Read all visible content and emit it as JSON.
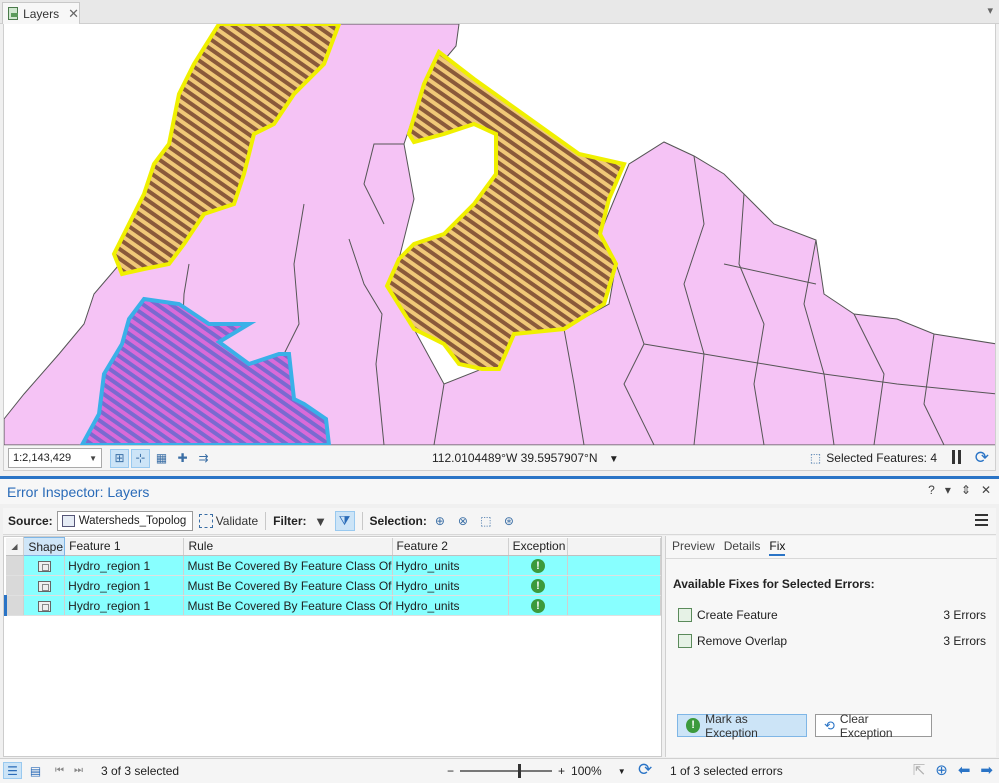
{
  "tab": {
    "label": "Layers"
  },
  "mapbar": {
    "scale": "1:2,143,429",
    "coordinates": "112.0104489°W 39.5957907°N",
    "selected_features": "Selected Features: 4"
  },
  "pane": {
    "title": "Error Inspector: Layers",
    "controls": [
      "?",
      "▾",
      "⇕",
      "✕"
    ]
  },
  "toolbar": {
    "source_label": "Source:",
    "source_value": "Watersheds_Topolog",
    "validate_label": "Validate",
    "filter_label": "Filter:",
    "selection_label": "Selection:"
  },
  "table": {
    "columns": [
      "Shape",
      "Feature 1",
      "Rule",
      "Feature 2",
      "Exception"
    ],
    "rows": [
      {
        "feature1": "Hydro_region 1",
        "rule": "Must Be Covered By Feature Class Of",
        "feature2": "Hydro_units"
      },
      {
        "feature1": "Hydro_region 1",
        "rule": "Must Be Covered By Feature Class Of",
        "feature2": "Hydro_units"
      },
      {
        "feature1": "Hydro_region 1",
        "rule": "Must Be Covered By Feature Class Of",
        "feature2": "Hydro_units"
      }
    ]
  },
  "fixpanel": {
    "tabs": [
      "Preview",
      "Details",
      "Fix"
    ],
    "heading": "Available Fixes for Selected Errors:",
    "fixes": [
      {
        "label": "Create Feature",
        "count": "3  Errors"
      },
      {
        "label": "Remove Overlap",
        "count": "3  Errors"
      }
    ],
    "mark_exception": "Mark as Exception",
    "clear_exception": "Clear Exception"
  },
  "statusbar": {
    "selected_count": "3 of 3 selected",
    "zoom": "100%",
    "selected_errors": "1 of 3 selected errors"
  },
  "colors": {
    "polygon_fill": "#f5c3f5",
    "error_hatch": "#8a5a3a",
    "highlight_yellow": "#f0f000",
    "highlight_cyan": "#3ab0e8",
    "selected_row": "#88ffff",
    "accent": "#2a74c6"
  }
}
